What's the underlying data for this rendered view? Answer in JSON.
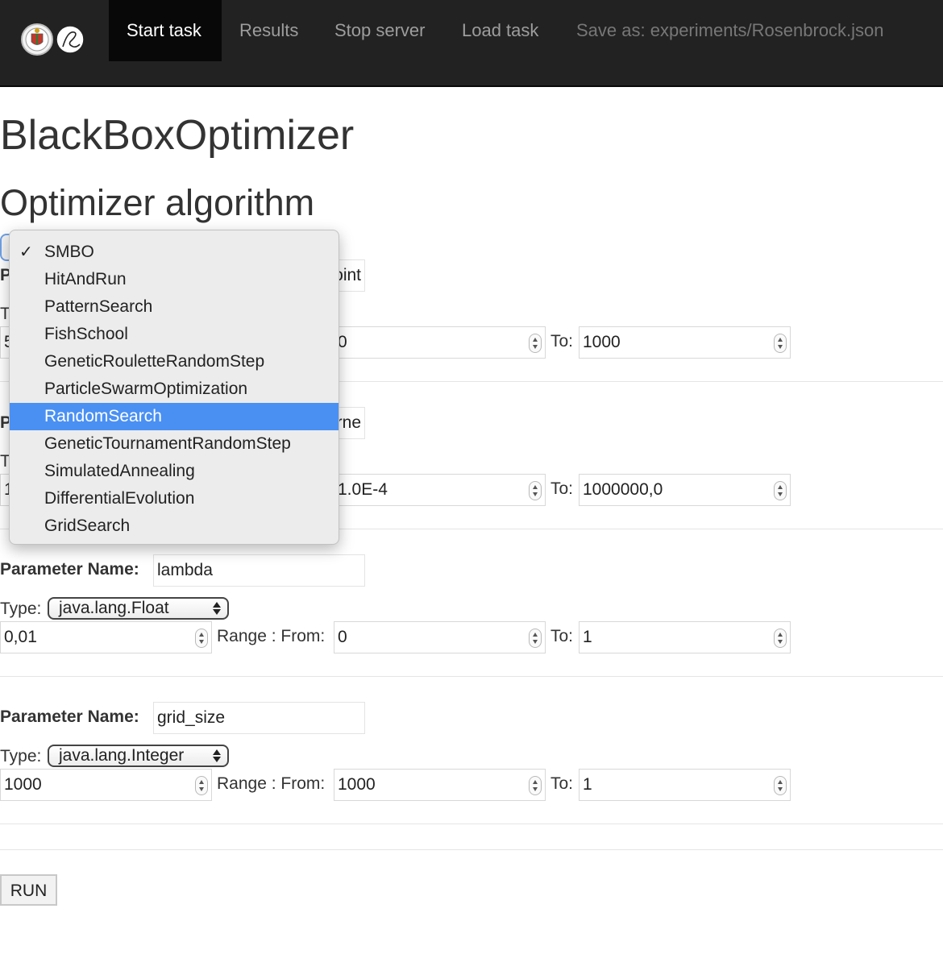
{
  "navbar": {
    "items": [
      {
        "label": "Start task",
        "active": true
      },
      {
        "label": "Results"
      },
      {
        "label": "Stop server"
      },
      {
        "label": "Load task"
      }
    ],
    "save_as": "Save as: experiments/Rosenbrock.json",
    "colors": {
      "background": "#222222",
      "active": "#080808",
      "text": "#9d9d9d"
    }
  },
  "page": {
    "title": "BlackBoxOptimizer",
    "section_title": "Optimizer algorithm"
  },
  "algorithm_menu": {
    "selected": "SMBO",
    "hovered": "RandomSearch",
    "check_mark": "✓",
    "options": [
      "SMBO",
      "HitAndRun",
      "PatternSearch",
      "FishSchool",
      "GeneticRouletteRandomStep",
      "ParticleSwarmOptimization",
      "RandomSearch",
      "GeneticTournamentRandomStep",
      "SimulatedAnnealing",
      "DifferentialEvolution",
      "GridSearch"
    ],
    "highlight_color": "#4a90f3"
  },
  "labels": {
    "param_name": "Parameter Name:",
    "type": "Type:",
    "range_from": "Range : From:",
    "to": "To:"
  },
  "params": [
    {
      "name_partial": "oint",
      "type_partial": "T",
      "value_partial": "5",
      "from_partial": "0",
      "to": "1000",
      "label_partial": "P"
    },
    {
      "name_partial": "rne",
      "type_partial": "T",
      "value_partial": "1",
      "from_partial": "1.0E-4",
      "to": "1000000,0",
      "label_partial": "P"
    },
    {
      "name": "lambda",
      "type": "java.lang.Float",
      "value": "0,01",
      "from": "0",
      "to": "1"
    },
    {
      "name": "grid_size",
      "type": "java.lang.Integer",
      "value": "1000",
      "from": "1000",
      "to": "1"
    }
  ],
  "run_button": "RUN"
}
